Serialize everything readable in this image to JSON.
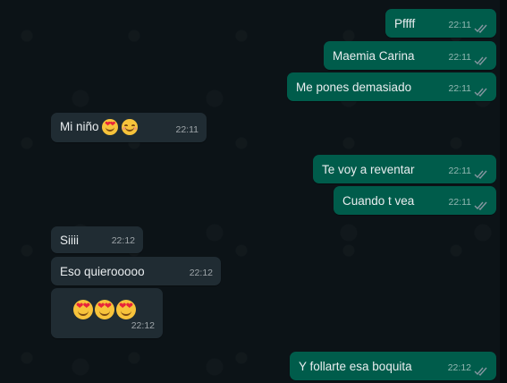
{
  "conversation": {
    "messages": [
      {
        "id": "m1",
        "direction": "outgoing",
        "text": "Pffff",
        "time": "22:11",
        "status": "read"
      },
      {
        "id": "m2",
        "direction": "outgoing",
        "text": "Maemia Carina",
        "time": "22:11",
        "status": "read"
      },
      {
        "id": "m3",
        "direction": "outgoing",
        "text": "Me pones demasiado",
        "time": "22:11",
        "status": "read"
      },
      {
        "id": "m4",
        "direction": "incoming",
        "text": "Mi niño",
        "emojis": [
          "heart-eyes",
          "smiling-face"
        ],
        "time": "22:11"
      },
      {
        "id": "m5",
        "direction": "outgoing",
        "text": "Te voy a reventar",
        "time": "22:11",
        "status": "read"
      },
      {
        "id": "m6",
        "direction": "outgoing",
        "text": "Cuando t vea",
        "time": "22:11",
        "status": "read"
      },
      {
        "id": "m7",
        "direction": "incoming",
        "text": "Siiii",
        "time": "22:12"
      },
      {
        "id": "m8",
        "direction": "incoming",
        "text": "Eso quierooooo",
        "time": "22:12"
      },
      {
        "id": "m9",
        "direction": "incoming",
        "text": "",
        "emojis": [
          "heart-eyes",
          "heart-eyes",
          "heart-eyes"
        ],
        "time": "22:12"
      },
      {
        "id": "m10",
        "direction": "outgoing",
        "text": "Y follarte esa boquita",
        "time": "22:12",
        "status": "read"
      }
    ]
  },
  "colors": {
    "outgoing_bubble": "#005c4b",
    "incoming_bubble": "#202c33",
    "background": "#0c1317",
    "read_ticks": "#8696a0"
  }
}
